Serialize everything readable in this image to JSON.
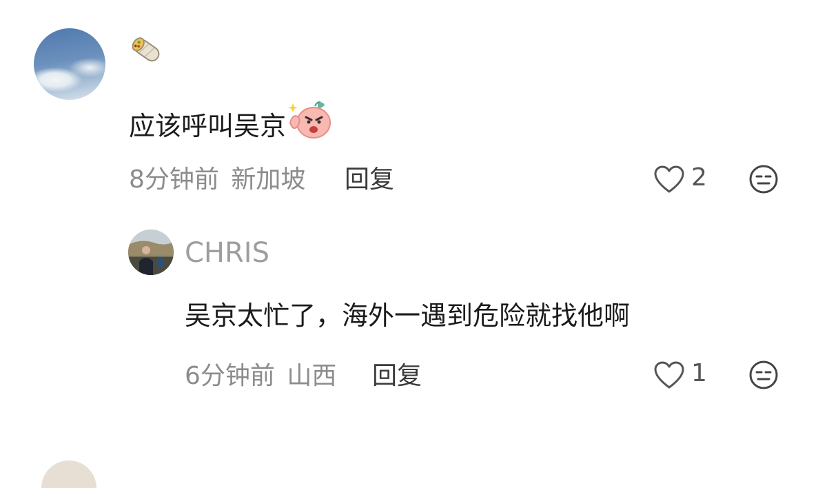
{
  "comment": {
    "text": "应该呼叫吴京",
    "time": "8分钟前",
    "location": "新加坡",
    "reply_label": "回复",
    "likes": "2"
  },
  "reply": {
    "username": "CHRIS",
    "text": "吴京太忙了，海外一遇到危险就找他啊",
    "time": "6分钟前",
    "location": "山西",
    "reply_label": "回复",
    "likes": "1"
  },
  "icons": {
    "badge": "burrito-icon",
    "emoji": "angry-blob-emoji",
    "like": "heart-outline-icon",
    "react": "neutral-face-icon"
  }
}
